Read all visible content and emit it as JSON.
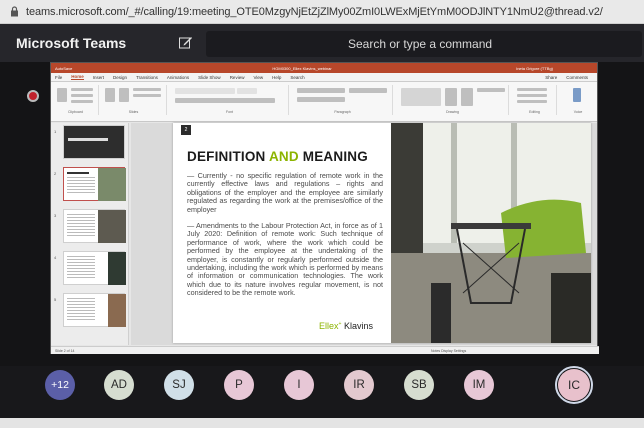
{
  "browser": {
    "url": "teams.microsoft.com/_#/calling/19:meeting_OTE0MzgyNjEtZjZlMy00ZmI0LWExMjEtYmM0ODJlNTY1NmU2@thread.v2/"
  },
  "teams": {
    "app_title": "Microsoft Teams",
    "search_placeholder": "Search or type a command"
  },
  "powerpoint": {
    "file_title": "HGM0300_Ellex Klavins_webinar",
    "user_name": "Ineta Grigore (TTBg)",
    "tabs": [
      "File",
      "Home",
      "Insert",
      "Design",
      "Transitions",
      "Animations",
      "Slide Show",
      "Review",
      "View",
      "Help"
    ],
    "tell_me": "Search",
    "share": "Share",
    "comments": "Comments",
    "ribbon_groups": [
      "Clipboard",
      "Slides",
      "Font",
      "Paragraph",
      "Drawing",
      "Editing",
      "Voice"
    ],
    "status_left": "Slide 2 of 14",
    "status_right": "Notes   Display Settings"
  },
  "slide": {
    "number": "2",
    "title_a": "DEFINITION",
    "title_and": "AND",
    "title_b": "MEANING",
    "para1": "— Currently - no specific regulation of remote work in the currently effective laws and regulations – rights and obligations of the employer and the employee are similarly regulated as regarding the work at the premises/office of the employer",
    "para2": "— Amendments to the Labour Protection Act, in force as of 1 July 2020: Definition of remote work: Such technique of performance of work, where the work which could be performed by the employee at the undertaking of the employer, is constantly or regularly performed outside the undertaking, including the work which is performed by means of information or communication technologies. The work which due to its nature involves regular movement, is not considered to be the remote work.",
    "logo_a": "Ellex",
    "logo_b": "Klavins"
  },
  "participants": [
    {
      "initials": "+12",
      "color": "#5b5fa8"
    },
    {
      "initials": "AD",
      "color": "#d6ddd0"
    },
    {
      "initials": "SJ",
      "color": "#d0dfe8"
    },
    {
      "initials": "P",
      "color": "#e7c7d6"
    },
    {
      "initials": "I",
      "color": "#e7c7d6"
    },
    {
      "initials": "IR",
      "color": "#e3c9cf"
    },
    {
      "initials": "SB",
      "color": "#d6ddd0"
    },
    {
      "initials": "IM",
      "color": "#e7c7d6"
    },
    {
      "initials": "IC",
      "color": "#e8c1cc"
    }
  ]
}
